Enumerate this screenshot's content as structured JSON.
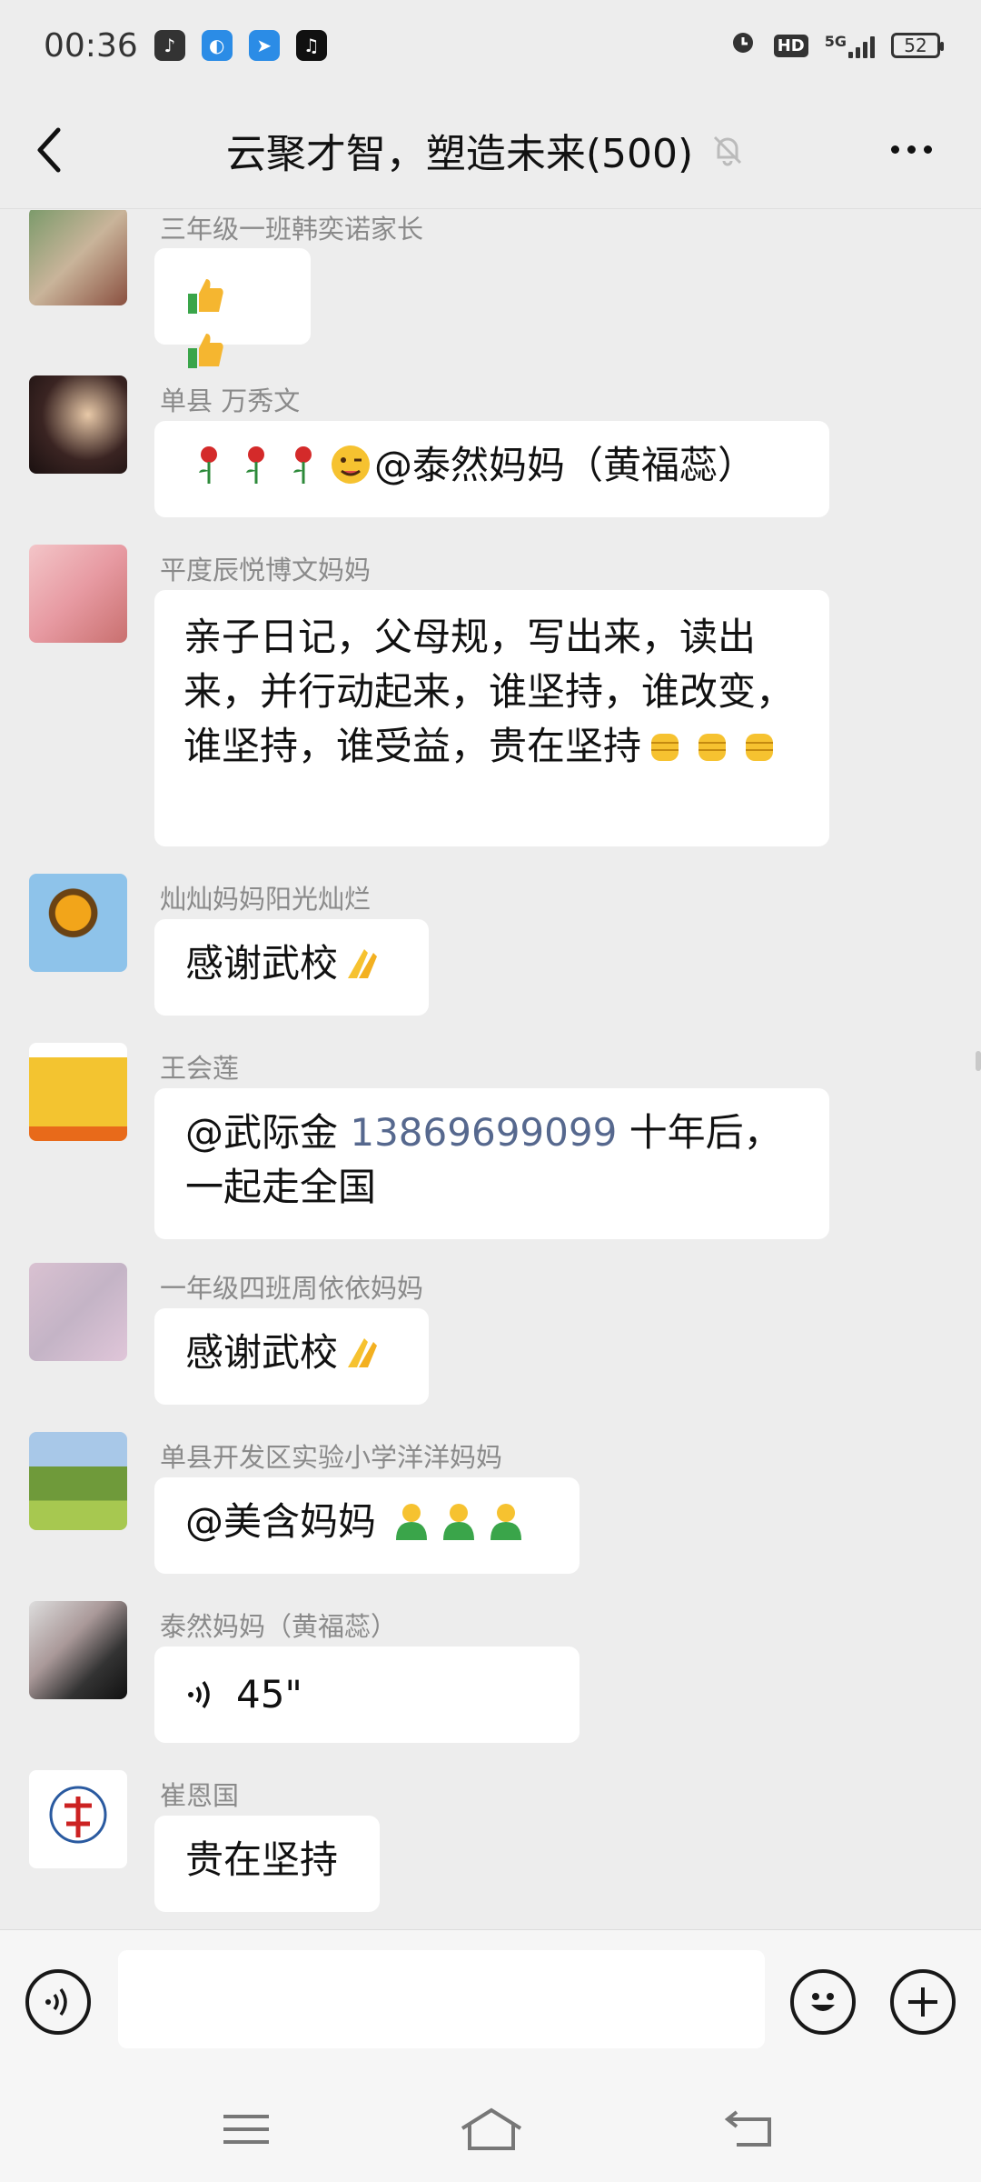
{
  "status_bar": {
    "time": "00:36",
    "network": "5G",
    "hd_label": "HD",
    "battery": "52"
  },
  "header": {
    "title": "云聚才智，塑造未来(500)",
    "back_icon": "back-arrow-icon",
    "mute_icon": "bell-muted-icon",
    "more_icon": "more-dots-icon"
  },
  "messages": [
    {
      "sender": "三年级一班韩奕诺家长",
      "text": "",
      "emoji": [
        "thumbs-up",
        "thumbs-up"
      ]
    },
    {
      "sender": "单县   万秀文",
      "text": "@泰然妈妈（黄福蕊）",
      "emoji_before": [
        "rose",
        "rose",
        "rose",
        "wink"
      ]
    },
    {
      "sender": "平度辰悦博文妈妈",
      "text": "亲子日记，父母规，写出来，读出来，并行动起来，谁坚持，谁改变，谁坚持，谁受益，贵在坚持",
      "emoji": [
        "fist",
        "fist",
        "fist"
      ]
    },
    {
      "sender": "灿灿妈妈阳光灿烂",
      "text": "感谢武校",
      "emoji": [
        "pray"
      ]
    },
    {
      "sender": "王会莲",
      "text_prefix": "@武际金 ",
      "link": "13869699099",
      "text_suffix": " 十年后，一起走全国"
    },
    {
      "sender": "一年级四班周依依妈妈",
      "text": "感谢武校",
      "emoji": [
        "pray"
      ]
    },
    {
      "sender": "单县开发区实验小学洋洋妈妈",
      "text": "@美含妈妈 ",
      "emoji": [
        "person",
        "person",
        "person"
      ]
    },
    {
      "sender": "泰然妈妈（黄福蕊）",
      "voice_duration": "45\"",
      "voice_icon": "voice-wave-icon"
    },
    {
      "sender": "崔恩国",
      "text": "贵在坚持"
    }
  ],
  "input": {
    "placeholder": "",
    "voice_icon": "voice-icon",
    "emoji_icon": "smiley-icon",
    "plus_icon": "plus-icon"
  },
  "system_nav": {
    "menu_icon": "menu-icon",
    "home_icon": "home-icon",
    "back_icon": "return-icon"
  }
}
